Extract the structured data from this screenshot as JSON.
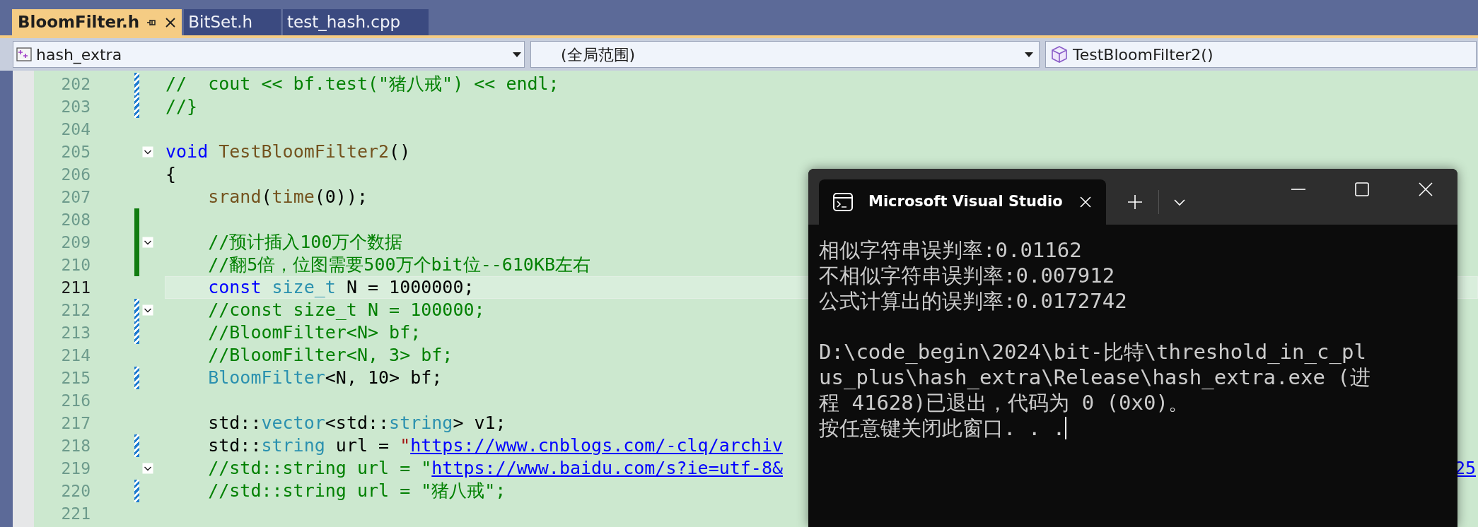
{
  "tabs": [
    {
      "label": "BloomFilter.h",
      "selected": true
    },
    {
      "label": "BitSet.h",
      "selected": false
    },
    {
      "label": "test_hash.cpp",
      "selected": false
    }
  ],
  "nav": {
    "project": "hash_extra",
    "scope": "(全局范围)",
    "member": "TestBloomFilter2()"
  },
  "code": {
    "lines": [
      {
        "number": "202",
        "current": false,
        "fold_toggle": false,
        "saved": false,
        "edited": true,
        "tokens": [
          {
            "kind": "comment",
            "text": "//  cout << bf.test(\"猪八戒\") << endl;"
          }
        ]
      },
      {
        "number": "203",
        "current": false,
        "fold_toggle": false,
        "saved": false,
        "edited": true,
        "tokens": [
          {
            "kind": "comment",
            "text": "//}"
          }
        ]
      },
      {
        "number": "204",
        "current": false,
        "fold_toggle": false,
        "saved": false,
        "edited": false
      },
      {
        "number": "205",
        "current": false,
        "fold_toggle": true,
        "saved": false,
        "edited": false,
        "tokens": [
          {
            "kind": "keyword",
            "text": "void"
          },
          {
            "kind": "function",
            "text": " TestBloomFilter2"
          },
          {
            "kind": "plain",
            "text": "()"
          }
        ]
      },
      {
        "number": "206",
        "current": false,
        "fold_toggle": false,
        "saved": false,
        "edited": false,
        "tokens": [
          {
            "kind": "plain",
            "text": "{"
          }
        ]
      },
      {
        "number": "207",
        "current": false,
        "fold_toggle": false,
        "saved": false,
        "edited": false,
        "tokens": [
          {
            "kind": "function",
            "text": "    srand"
          },
          {
            "kind": "plain",
            "text": "("
          },
          {
            "kind": "function",
            "text": "time"
          },
          {
            "kind": "plain",
            "text": "(0));"
          }
        ]
      },
      {
        "number": "208",
        "current": false,
        "fold_toggle": false,
        "saved": true,
        "edited": false
      },
      {
        "number": "209",
        "current": false,
        "fold_toggle": true,
        "saved": true,
        "edited": false,
        "tokens": [
          {
            "kind": "comment",
            "text": "    //预计插入100万个数据"
          }
        ]
      },
      {
        "number": "210",
        "current": false,
        "fold_toggle": false,
        "saved": true,
        "edited": false,
        "tokens": [
          {
            "kind": "comment",
            "text": "    //翻5倍，位图需要500万个bit位--610KB左右"
          }
        ]
      },
      {
        "number": "211",
        "current": true,
        "fold_toggle": false,
        "saved": false,
        "edited": false,
        "tokens": [
          {
            "kind": "keyword",
            "text": "    const"
          },
          {
            "kind": "type",
            "text": " size_t"
          },
          {
            "kind": "plain",
            "text": " N = 1000000;"
          }
        ]
      },
      {
        "number": "212",
        "current": false,
        "fold_toggle": true,
        "saved": false,
        "edited": true,
        "tokens": [
          {
            "kind": "comment",
            "text": "    //const size_t N = 100000;"
          }
        ]
      },
      {
        "number": "213",
        "current": false,
        "fold_toggle": false,
        "saved": false,
        "edited": true,
        "tokens": [
          {
            "kind": "comment",
            "text": "    //BloomFilter<N> bf;"
          }
        ]
      },
      {
        "number": "214",
        "current": false,
        "fold_toggle": false,
        "saved": false,
        "edited": false,
        "tokens": [
          {
            "kind": "comment",
            "text": "    //BloomFilter<N, 3> bf;"
          }
        ]
      },
      {
        "number": "215",
        "current": false,
        "fold_toggle": false,
        "saved": false,
        "edited": true,
        "tokens": [
          {
            "kind": "type",
            "text": "    BloomFilter"
          },
          {
            "kind": "plain",
            "text": "<N, 10> bf;"
          }
        ]
      },
      {
        "number": "216",
        "current": false,
        "fold_toggle": false,
        "saved": false,
        "edited": false
      },
      {
        "number": "217",
        "current": false,
        "fold_toggle": false,
        "saved": false,
        "edited": false,
        "tokens": [
          {
            "kind": "plain",
            "text": "    std::"
          },
          {
            "kind": "type",
            "text": "vector"
          },
          {
            "kind": "plain",
            "text": "<std::"
          },
          {
            "kind": "type",
            "text": "string"
          },
          {
            "kind": "plain",
            "text": "> v1;"
          }
        ]
      },
      {
        "number": "218",
        "current": false,
        "fold_toggle": false,
        "saved": false,
        "edited": true,
        "tokens": [
          {
            "kind": "plain",
            "text": "    std::"
          },
          {
            "kind": "type",
            "text": "string"
          },
          {
            "kind": "plain",
            "text": " url = "
          },
          {
            "kind": "string",
            "text": "\""
          },
          {
            "kind": "link",
            "text": "https://www.cnblogs.com/-clq/archiv"
          }
        ]
      },
      {
        "number": "219",
        "current": false,
        "fold_toggle": true,
        "saved": false,
        "edited": false,
        "tokens": [
          {
            "kind": "comment",
            "text": "    //std::string url = \""
          },
          {
            "kind": "link",
            "text": "https://www.baidu.com/s?ie=utf-8&"
          }
        ],
        "tail": "25"
      },
      {
        "number": "220",
        "current": false,
        "fold_toggle": false,
        "saved": false,
        "edited": true,
        "tokens": [
          {
            "kind": "comment",
            "text": "    //std::string url = \"猪八戒\";"
          }
        ]
      },
      {
        "number": "221",
        "current": false,
        "fold_toggle": false,
        "saved": false,
        "edited": false
      }
    ]
  },
  "console": {
    "title": "Microsoft Visual Studio",
    "results": [
      "相似字符串误判率:0.01162",
      "不相似字符串误判率:0.007912",
      "公式计算出的误判率:0.0172742"
    ],
    "exit_message": [
      "D:\\code_begin\\2024\\bit-比特\\threshold_in_c_pl",
      "us_plus\\hash_extra\\Release\\hash_extra.exe (进",
      "程 41628)已退出，代码为 0 (0x0)。"
    ],
    "prompt": "按任意键关闭此窗口. . .",
    "cursor": true
  }
}
